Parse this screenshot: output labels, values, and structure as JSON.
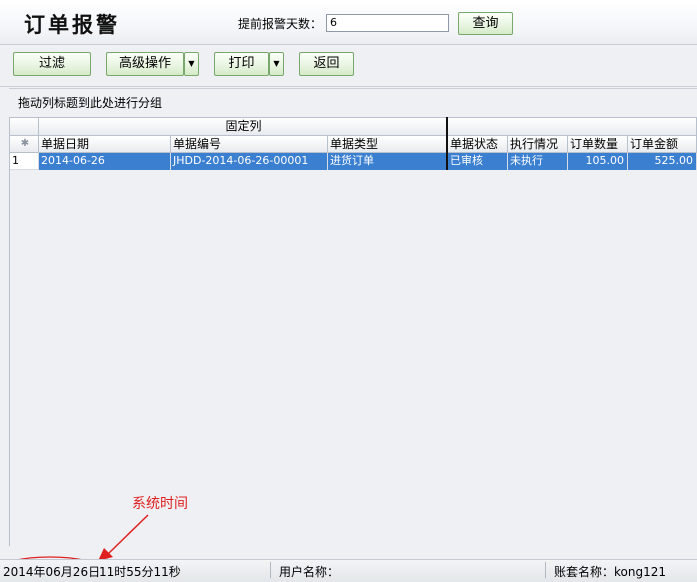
{
  "header": {
    "title": "订单报警",
    "alert_days_label": "提前报警天数：",
    "alert_days_value": "6",
    "query_button": "查询"
  },
  "toolbar": {
    "filter": "过滤",
    "advanced": "高级操作",
    "print": "打印",
    "back": "返回",
    "dropdown_arrow": "▼"
  },
  "group_panel": {
    "text": "拖动列标题到此处进行分组"
  },
  "grid": {
    "band_header": "固定列",
    "indicator_symbol": "✱",
    "columns": [
      "单据日期",
      "单据编号",
      "单据类型",
      "单据状态",
      "执行情况",
      "订单数量",
      "订单金额"
    ],
    "rows": [
      {
        "index": "1",
        "date": "2014-06-26",
        "number": "JHDD-2014-06-26-00001",
        "type": "进货订单",
        "status": "已审核",
        "execution": "未执行",
        "quantity": "105.00",
        "amount": "525.00"
      }
    ]
  },
  "annotation": {
    "text": "系统时间",
    "color": "#e02020"
  },
  "status_bar": {
    "date": "2014年06月26日",
    "time": "11时55分11秒",
    "user_label": "用户名称：",
    "account_label": "账套名称：kong121"
  }
}
